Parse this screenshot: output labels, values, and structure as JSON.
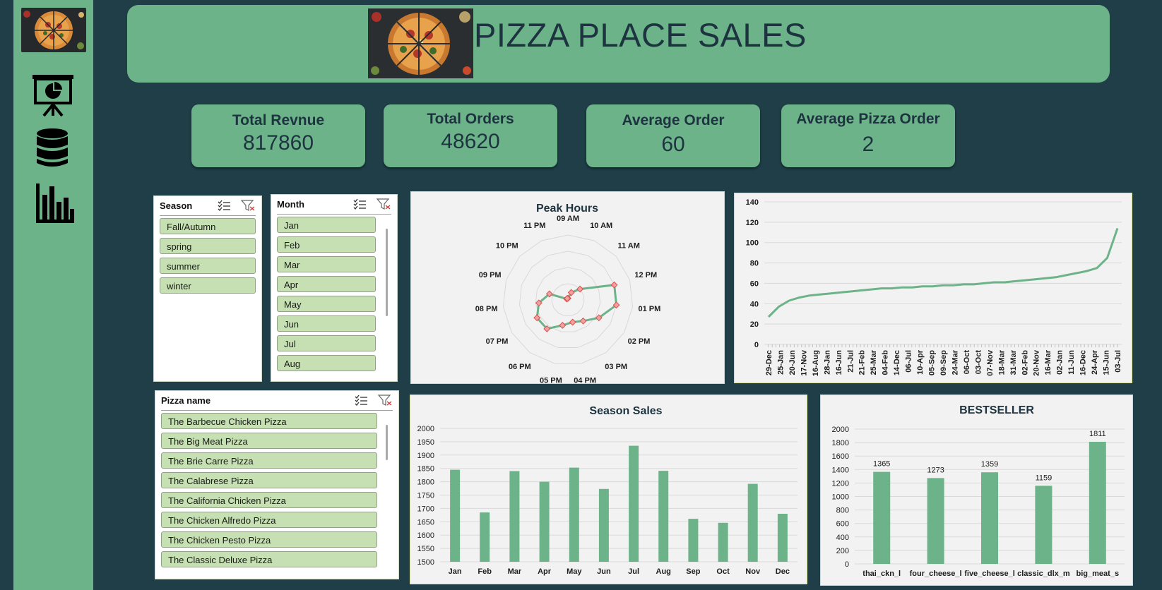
{
  "header": {
    "title": "PIZZA PLACE SALES"
  },
  "sidebar": {
    "icons": [
      "pizza-thumbnail",
      "presentation-chart-icon",
      "database-icon",
      "bar-chart-icon"
    ]
  },
  "kpis": [
    {
      "label": "Total Revnue",
      "value": "817860"
    },
    {
      "label": "Total Orders",
      "value": "48620"
    },
    {
      "label": "Average Order",
      "value": "60"
    },
    {
      "label": "Average Pizza Order",
      "value": "2"
    }
  ],
  "slicers": {
    "season": {
      "title": "Season",
      "items": [
        "Fall/Autumn",
        "spring",
        "summer",
        "winter"
      ]
    },
    "month": {
      "title": "Month",
      "items": [
        "Jan",
        "Feb",
        "Mar",
        "Apr",
        "May",
        "Jun",
        "Jul",
        "Aug"
      ]
    },
    "pizza": {
      "title": "Pizza name",
      "items": [
        "The Barbecue Chicken Pizza",
        "The Big Meat Pizza",
        "The Brie Carre Pizza",
        "The Calabrese Pizza",
        "The California Chicken Pizza",
        "The Chicken Alfredo Pizza",
        "The Chicken Pesto Pizza",
        "The Classic Deluxe Pizza"
      ]
    }
  },
  "colors": {
    "background": "#1f3e47",
    "panel": "#6db389",
    "series": "#6db389",
    "slicer_item": "#c6e0b4",
    "marker": "#d9534f"
  },
  "chart_data": [
    {
      "type": "radar",
      "title": "Peak Hours",
      "categories": [
        "09 AM",
        "10 AM",
        "11 AM",
        "12 PM",
        "01 PM",
        "02 PM",
        "03 PM",
        "04 PM",
        "05 PM",
        "06 PM",
        "07 PM",
        "08 PM",
        "09 PM",
        "10 PM",
        "11 PM"
      ],
      "values": [
        0.1,
        0.5,
        1.0,
        3.0,
        3.0,
        2.2,
        1.6,
        1.4,
        1.6,
        2.2,
        2.2,
        1.8,
        1.2,
        0.1,
        0.1
      ],
      "rmax": 4,
      "grid": true
    },
    {
      "type": "line",
      "title": "",
      "ylim": [
        0,
        140
      ],
      "yticks": [
        0,
        20,
        40,
        60,
        80,
        100,
        120,
        140
      ],
      "xtick_labels": [
        "29-Dec",
        "25-Jan",
        "20-Jun",
        "17-Nov",
        "16-Aug",
        "28-Jan",
        "16-Jun",
        "21-Jul",
        "21-Feb",
        "25-Mar",
        "04-Feb",
        "14-Dec",
        "06-Jul",
        "10-Apr",
        "05-Sep",
        "09-Sep",
        "24-Mar",
        "06-Oct",
        "03-Oct",
        "07-Nov",
        "18-Mar",
        "31-Mar",
        "02-Feb",
        "20-Nov",
        "16-Mar",
        "02-Jan",
        "11-Jun",
        "16-Dec",
        "24-Apr",
        "15-Jun",
        "03-Jul"
      ],
      "series": [
        {
          "values": [
            27,
            37,
            43,
            46,
            48,
            49,
            50,
            51,
            52,
            53,
            54,
            55,
            55,
            56,
            56,
            57,
            57,
            58,
            58,
            59,
            59,
            60,
            61,
            61,
            62,
            63,
            64,
            65,
            66,
            68,
            70,
            72,
            75,
            85,
            114
          ]
        }
      ],
      "grid": true
    },
    {
      "type": "bar",
      "title": "Season Sales",
      "categories": [
        "Jan",
        "Feb",
        "Mar",
        "Apr",
        "May",
        "Jun",
        "Jul",
        "Aug",
        "Sep",
        "Oct",
        "Nov",
        "Dec"
      ],
      "values": [
        1845,
        1685,
        1840,
        1800,
        1853,
        1773,
        1935,
        1841,
        1661,
        1646,
        1792,
        1680
      ],
      "ylim": [
        1500,
        2000
      ],
      "yticks": [
        1500,
        1550,
        1600,
        1650,
        1700,
        1750,
        1800,
        1850,
        1900,
        1950,
        2000
      ],
      "grid": true
    },
    {
      "type": "bar",
      "title": "BESTSELLER",
      "categories": [
        "thai_ckn_l",
        "four_cheese_l",
        "five_cheese_l",
        "classic_dlx_m",
        "big_meat_s"
      ],
      "values": [
        1365,
        1273,
        1359,
        1159,
        1811
      ],
      "data_labels": [
        "1365",
        "1273",
        "1359",
        "1159",
        "1811"
      ],
      "ylim": [
        0,
        2000
      ],
      "yticks": [
        0,
        200,
        400,
        600,
        800,
        1000,
        1200,
        1400,
        1600,
        1800,
        2000
      ],
      "grid": true
    }
  ]
}
